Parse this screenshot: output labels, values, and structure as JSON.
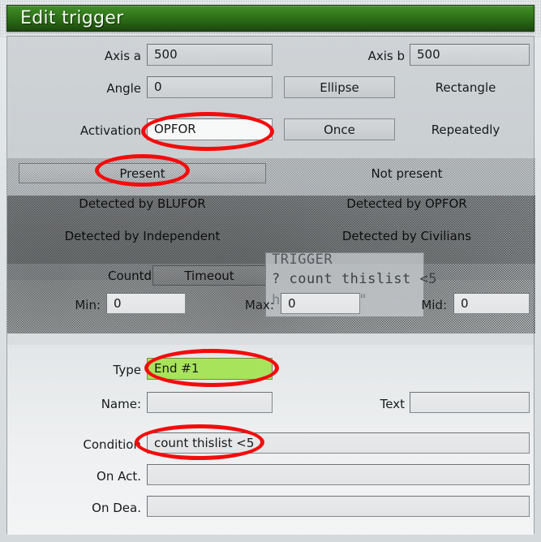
{
  "window": {
    "title": "Edit trigger"
  },
  "form": {
    "axis_a": {
      "label": "Axis a",
      "value": "500"
    },
    "axis_b": {
      "label": "Axis b",
      "value": "500"
    },
    "angle": {
      "label": "Angle",
      "value": "0"
    },
    "shape": {
      "ellipse": "Ellipse",
      "rectangle": "Rectangle"
    },
    "activation": {
      "label": "Activation",
      "value": "OPFOR"
    },
    "repetition": {
      "once": "Once",
      "repeatedly": "Repeatedly"
    },
    "presence": {
      "present": "Present",
      "not_present": "Not present"
    },
    "detection": [
      "Detected by BLUFOR",
      "Detected by OPFOR",
      "Detected by Independent",
      "Detected by Civilians"
    ],
    "timer_mode": {
      "countdown": "Countdown",
      "timeout": "Timeout"
    },
    "min": {
      "label": "Min:",
      "value": "0"
    },
    "max": {
      "label": "Max:",
      "value": "0"
    },
    "mid": {
      "label": "Mid:",
      "value": "0"
    },
    "type": {
      "label": "Type",
      "value": "End #1"
    },
    "name": {
      "label": "Name:",
      "value": ""
    },
    "text": {
      "label": "Text",
      "value": ""
    },
    "condition": {
      "label": "Condition",
      "value": "count thislist <5"
    },
    "on_act": {
      "label": "On Act.",
      "value": ""
    },
    "on_dea": {
      "label": "On Dea.",
      "value": ""
    }
  },
  "ghost_overlay": {
    "line1": "TRIGGER",
    "line2": "? count thislist <5",
    "line3": "hint \"done\""
  },
  "colors": {
    "titlebar_green": "#2a6616",
    "type_highlight_green": "#a8e35c",
    "annotation_red": "#f30c0c",
    "panel_gray": "#ccd1d3"
  }
}
